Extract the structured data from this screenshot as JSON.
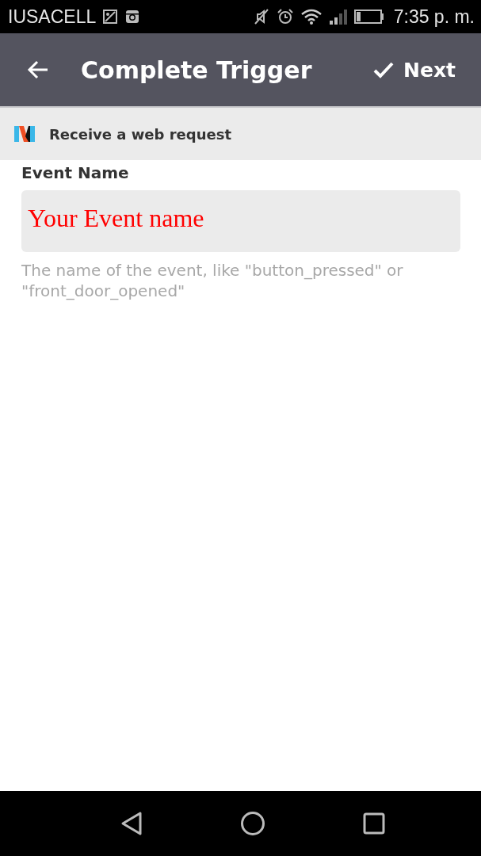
{
  "status_bar": {
    "carrier": "IUSACELL",
    "time": "7:35 p. m."
  },
  "header": {
    "title": "Complete Trigger",
    "next_label": "Next"
  },
  "service": {
    "label": "Receive a web request"
  },
  "field": {
    "label": "Event Name",
    "value": "Your Event name",
    "help": "The name of the event, like \"button_pressed\" or \"front_door_opened\""
  }
}
